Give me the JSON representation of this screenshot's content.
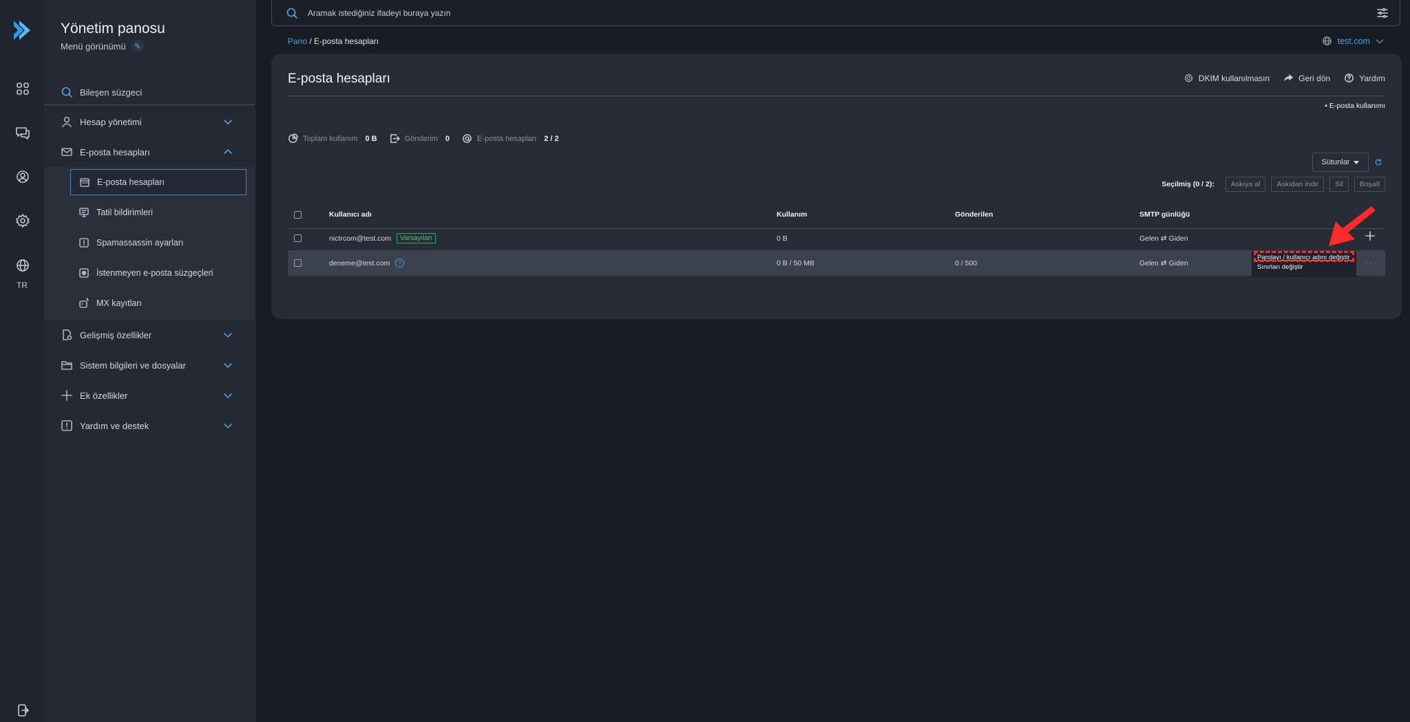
{
  "rail": {
    "language": "TR"
  },
  "sidebar": {
    "title": "Yönetim panosu",
    "subtitle": "Menü görünümü",
    "filter_label": "Bileşen süzgeci",
    "menu": [
      {
        "label": "Hesap yönetimi",
        "icon": "user-icon"
      },
      {
        "label": "E-posta hesapları",
        "icon": "envelope-icon"
      },
      {
        "label": "Gelişmiş özellikler",
        "icon": "settings-doc-icon"
      },
      {
        "label": "Sistem bilgileri ve dosyalar",
        "icon": "folder-icon"
      },
      {
        "label": "Ek özellikler",
        "icon": "plus-icon"
      },
      {
        "label": "Yardım ve destek",
        "icon": "alert-icon"
      }
    ],
    "submenu": [
      {
        "label": "E-posta hesapları",
        "icon": "calendar-icon",
        "active": true
      },
      {
        "label": "Tatil bildirimleri",
        "icon": "monitor-icon"
      },
      {
        "label": "Spamassassin ayarları",
        "icon": "alert-icon"
      },
      {
        "label": "İstenmeyen e-posta süzgeçleri",
        "icon": "filter-icon"
      },
      {
        "label": "MX kayıtları",
        "icon": "server-icon"
      }
    ]
  },
  "topsearch": {
    "placeholder": "Aramak istediğiniz ifadeyi buraya yazın"
  },
  "breadcrumb": {
    "root": "Pano",
    "separator": " / ",
    "current": "E-posta hesapları"
  },
  "domain": "test.com",
  "panel": {
    "title": "E-posta hesapları",
    "actions": {
      "dkim": "DKIM kullanılmasın",
      "back": "Geri dön",
      "help": "Yardım"
    },
    "usage_note": "• E-posta kullanımı",
    "stats": {
      "total_label": "Toplam kullanım",
      "total_value": "0 B",
      "send_label": "Gönderim",
      "send_value": "0",
      "accounts_label": "E-posta hesapları",
      "accounts_value": "2 / 2"
    },
    "columns_button": "Sütunlar",
    "bulk": {
      "selected": "Seçilmiş (0 / 2):",
      "suspend": "Askıya al",
      "unsuspend": "Askıdan indir",
      "delete": "Sil",
      "empty": "Boşalt"
    },
    "table": {
      "headers": [
        "Kullanıcı adı",
        "Kullanım",
        "Gönderilen",
        "SMTP günlüğü"
      ],
      "rows": [
        {
          "username": "nictrcom@test.com",
          "badge": "Varsayılan",
          "usage": "0 B",
          "sent": "",
          "smtp": "Gelen ⇄ Giden"
        },
        {
          "username": "deneme@test.com",
          "usage": "0 B / 50 MB",
          "sent": "0 / 500",
          "smtp": "Gelen ⇄ Giden"
        }
      ]
    },
    "row_menu": {
      "item1": "Parolayı / kullanıcı adını değiştir",
      "item2": "Sınırları değiştir"
    }
  },
  "colors": {
    "accent": "#4f9ee0",
    "highlight": "#ff2a2a",
    "badge": "#4fc27f"
  }
}
